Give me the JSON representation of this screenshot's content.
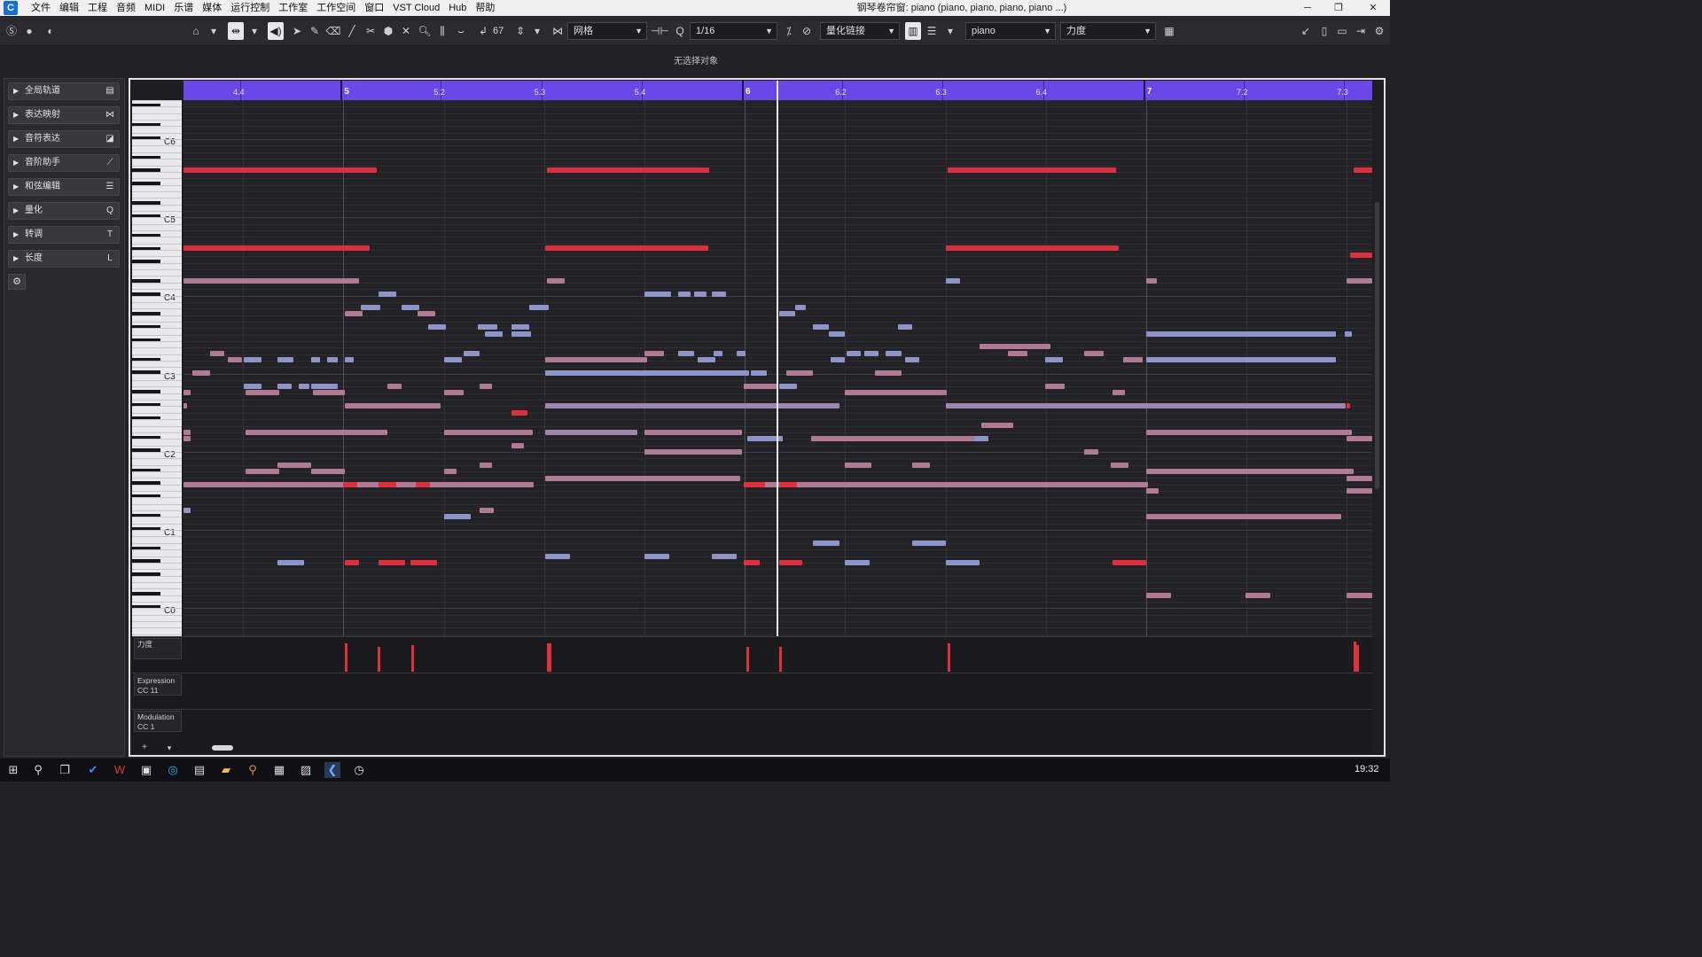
{
  "menubar": {
    "logo": "C",
    "items": [
      "文件",
      "编辑",
      "工程",
      "音频",
      "MIDI",
      "乐谱",
      "媒体",
      "运行控制",
      "工作室",
      "工作空间",
      "窗口",
      "VST Cloud",
      "Hub",
      "帮助"
    ],
    "window_title": "钢琴卷帘窗:  piano (piano, piano, piano, piano ...)",
    "minimize": "─",
    "restore": "❐",
    "close": "✕"
  },
  "toolbar": {
    "tempo_value": "67",
    "grid_type": "网格",
    "quantize_value": "1/16",
    "quantize_link": "量化链接",
    "track_name": "piano",
    "controller_lane": "力度"
  },
  "status": {
    "selection": "无选择对象"
  },
  "inspector": {
    "sections": [
      {
        "label": "全局轨道",
        "icon": "▤"
      },
      {
        "label": "表达映射",
        "icon": "⋈"
      },
      {
        "label": "音符表达",
        "icon": "◪"
      },
      {
        "label": "音阶助手",
        "icon": "⟋"
      },
      {
        "label": "和弦编辑",
        "icon": "☰"
      },
      {
        "label": "量化",
        "icon": "Q"
      },
      {
        "label": "转调",
        "icon": "T"
      },
      {
        "label": "长度",
        "icon": "L"
      }
    ],
    "settings_icon": "gear-icon"
  },
  "ruler": {
    "labels": [
      {
        "text": "4.4",
        "bar": false
      },
      {
        "text": "5",
        "bar": true
      },
      {
        "text": "5.2",
        "bar": false
      },
      {
        "text": "5.3",
        "bar": false
      },
      {
        "text": "5.4",
        "bar": false
      },
      {
        "text": "6",
        "bar": true
      },
      {
        "text": "6.2",
        "bar": false
      },
      {
        "text": "6.3",
        "bar": false
      },
      {
        "text": "6.4",
        "bar": false
      },
      {
        "text": "7",
        "bar": true
      },
      {
        "text": "7.2",
        "bar": false
      },
      {
        "text": "7.3",
        "bar": false
      }
    ]
  },
  "keyboard": {
    "octave_labels": [
      "C6",
      "C5",
      "C4",
      "C3",
      "C2",
      "C1",
      "C0"
    ]
  },
  "lanes": [
    {
      "name": "力度",
      "sub": ""
    },
    {
      "name": "Expression",
      "sub": "CC 11"
    },
    {
      "name": "Modulation",
      "sub": "CC 1"
    }
  ],
  "taskbar": {
    "time": "19:32"
  },
  "colors": {
    "ruler": "#6b46e8",
    "note_selected_red": "#d8303c",
    "note_blue": "#8c94c8",
    "note_pink": "#b07a95"
  }
}
